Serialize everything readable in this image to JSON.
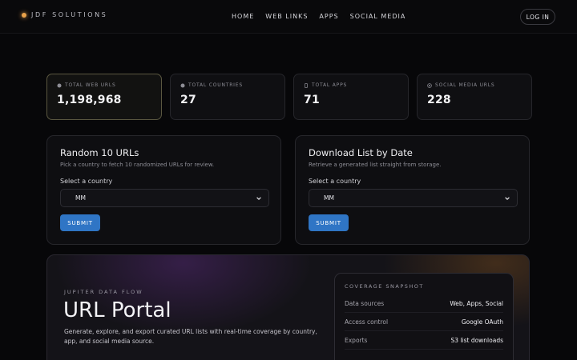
{
  "nav": {
    "brand": "JDF SOLUTIONS",
    "links": [
      "HOME",
      "WEB LINKS",
      "APPS",
      "SOCIAL MEDIA"
    ],
    "login_label": "LOG IN"
  },
  "stats": [
    {
      "label": "TOTAL WEB URLS",
      "value": "1,198,968",
      "icon": "globe-icon"
    },
    {
      "label": "TOTAL COUNTRIES",
      "value": "27",
      "icon": "compass-icon"
    },
    {
      "label": "TOTAL APPS",
      "value": "71",
      "icon": "phone-icon"
    },
    {
      "label": "SOCIAL MEDIA URLS",
      "value": "228",
      "icon": "at-icon"
    }
  ],
  "random_panel": {
    "title": "Random 10 URLs",
    "subtitle": "Pick a country to fetch 10 randomized URLs for review.",
    "field_label": "Select a country",
    "selected_country": "MM",
    "submit_label": "SUBMIT"
  },
  "download_panel": {
    "title": "Download List by Date",
    "subtitle": "Retrieve a generated list straight from storage.",
    "field_label": "Select a country",
    "selected_country": "MM",
    "submit_label": "SUBMIT"
  },
  "hero": {
    "eyebrow": "JUPITER DATA FLOW",
    "title": "URL Portal",
    "description": "Generate, explore, and export curated URL lists with real-time coverage by country, app, and social media source."
  },
  "snapshot": {
    "title": "COVERAGE SNAPSHOT",
    "rows": [
      {
        "key": "Data sources",
        "value": "Web, Apps, Social"
      },
      {
        "key": "Access control",
        "value": "Google OAuth"
      },
      {
        "key": "Exports",
        "value": "S3 list downloads"
      }
    ]
  },
  "colors": {
    "accent_blue": "#2f75c5",
    "brand_dot": "#e9a24a",
    "background": "#070709"
  }
}
